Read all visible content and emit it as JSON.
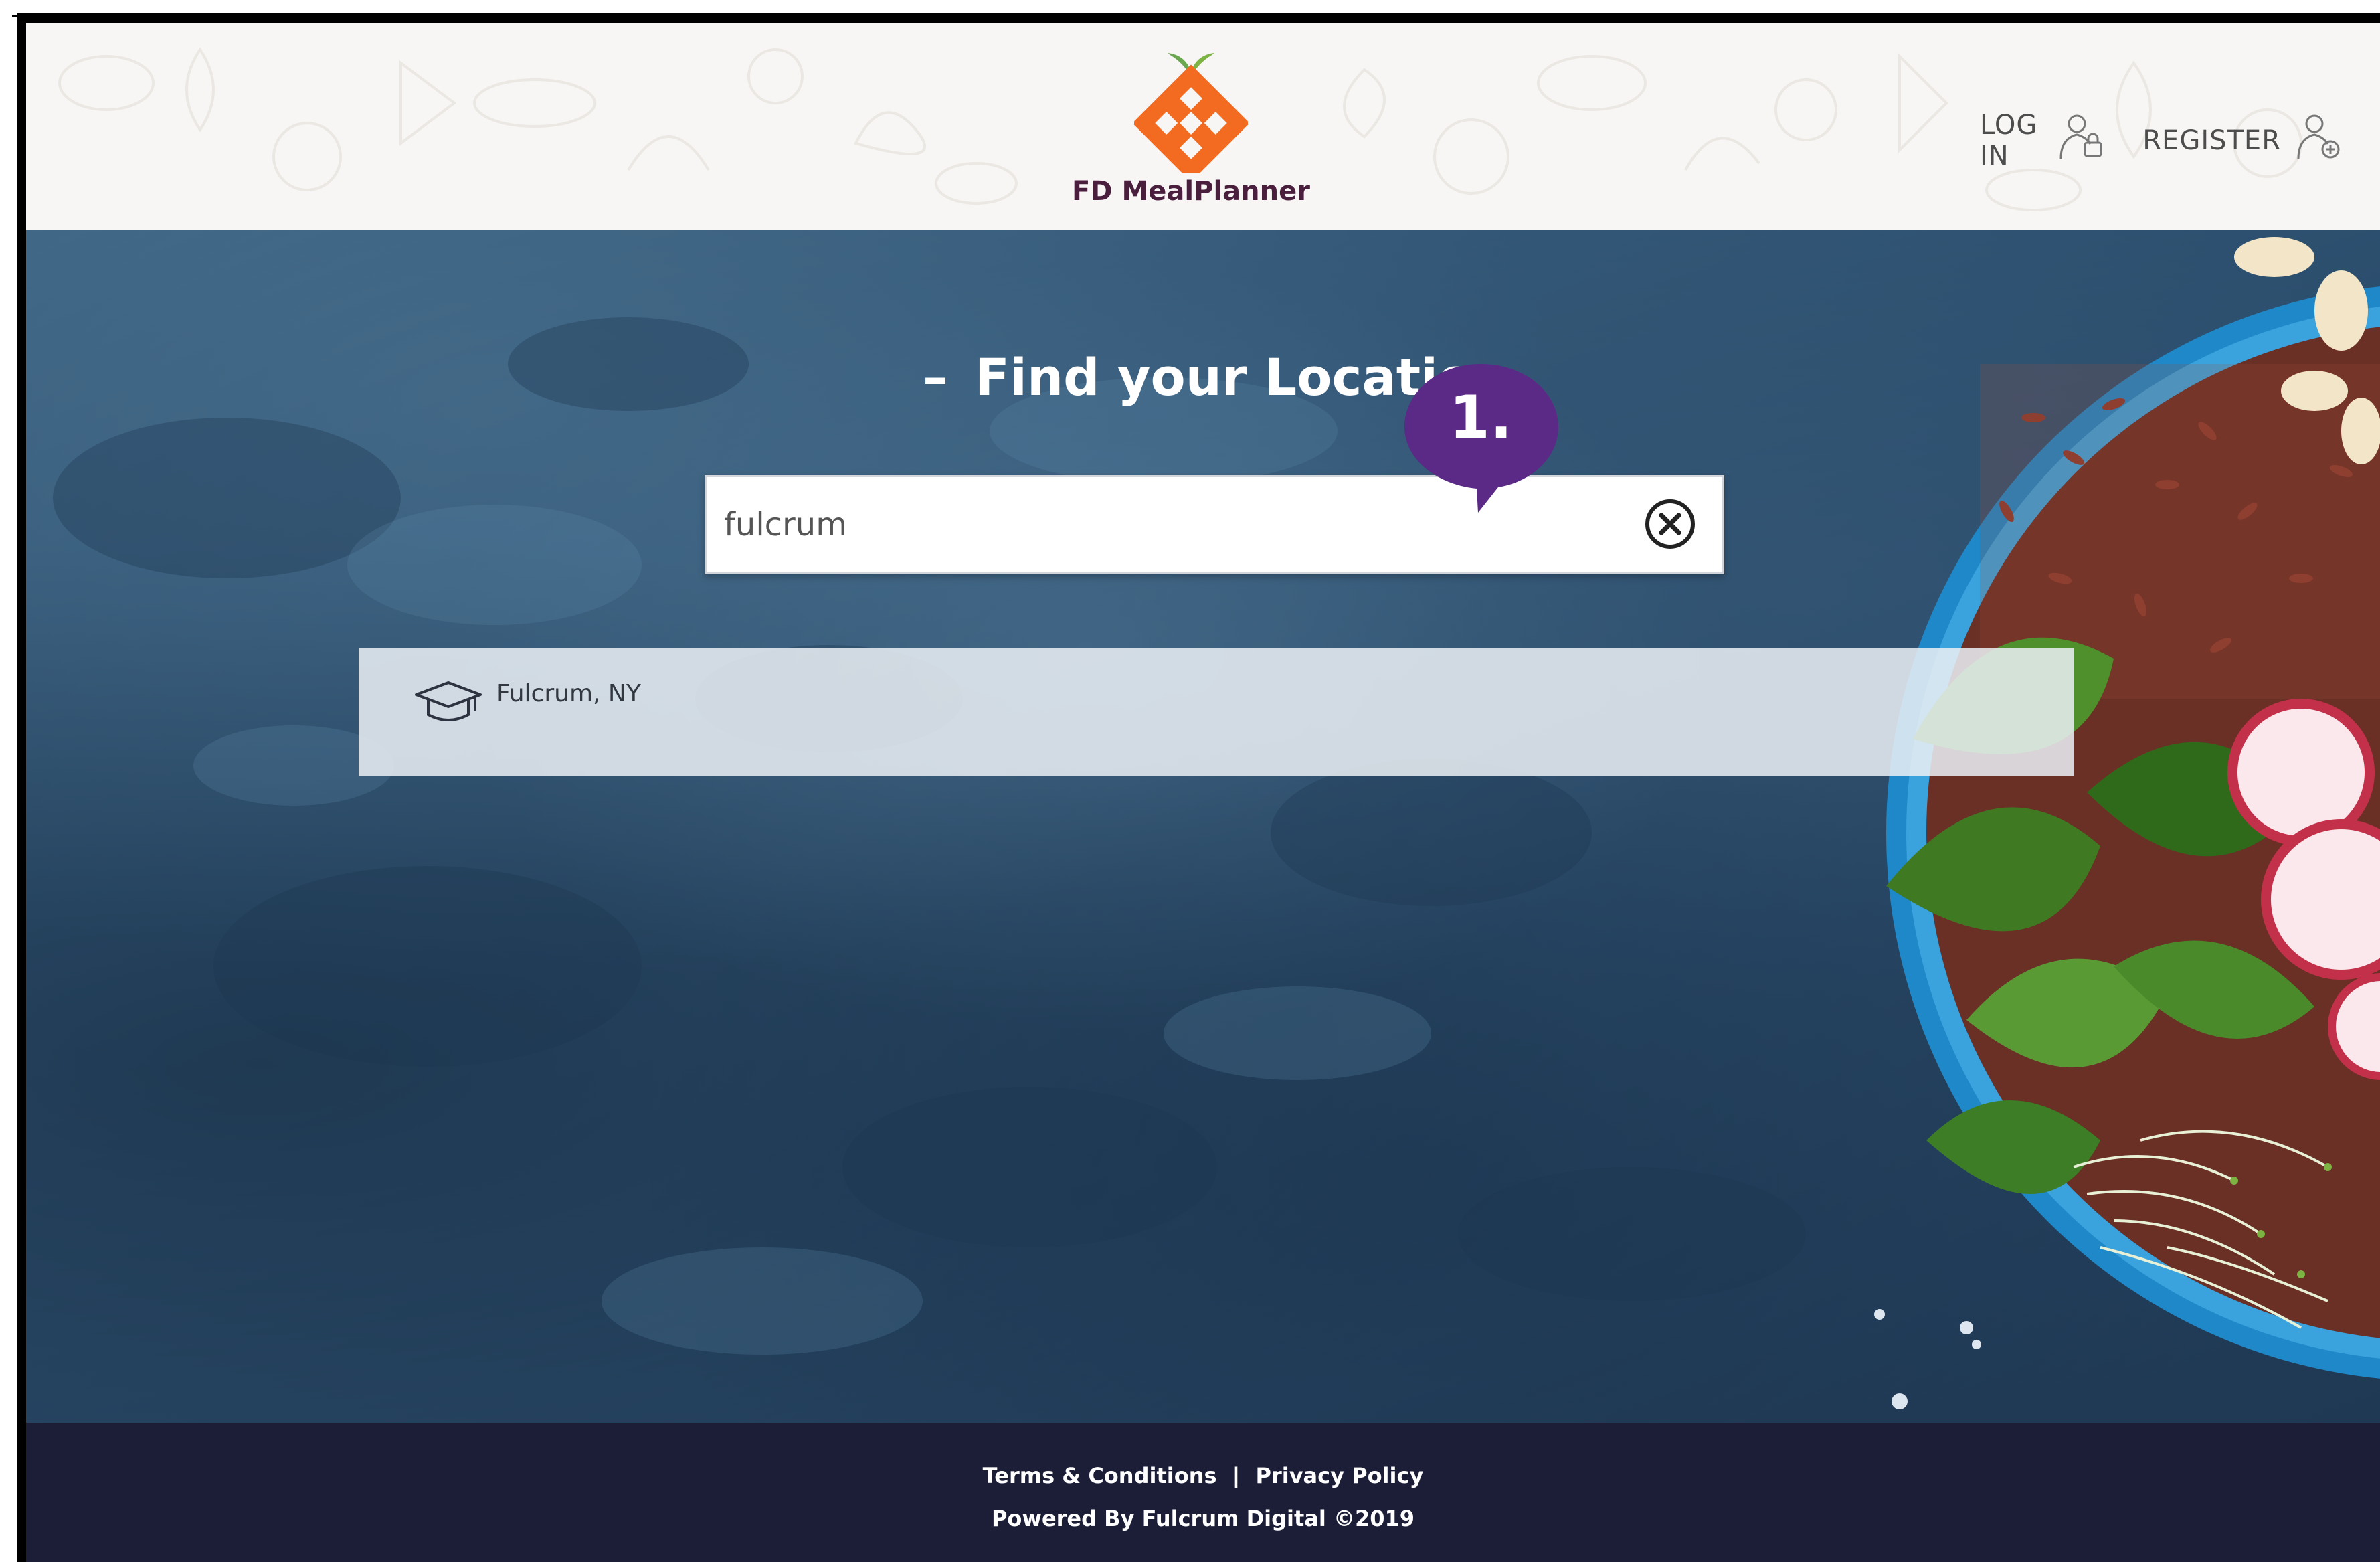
{
  "app": {
    "brand_name": "FD MealPlanner"
  },
  "header": {
    "login_label": "LOG IN",
    "register_label": "REGISTER"
  },
  "hero": {
    "title_dash": "–",
    "title": "Find your Location"
  },
  "search": {
    "value": "fulcrum",
    "placeholder": ""
  },
  "callout": {
    "label": "1."
  },
  "suggestions": [
    {
      "label": "Fulcrum, NY",
      "icon": "graduation-cap-icon"
    }
  ],
  "footer": {
    "terms_label": "Terms & Conditions",
    "separator": "|",
    "privacy_label": "Privacy Policy",
    "powered_by": "Powered By Fulcrum Digital ©2019"
  },
  "colors": {
    "brand_orange": "#f26b21",
    "brand_green": "#7cb342",
    "brand_text": "#4a1f3e",
    "callout_purple": "#5b2a86",
    "footer_bg": "#1c1e38",
    "hero_bg": "#2f5272"
  }
}
